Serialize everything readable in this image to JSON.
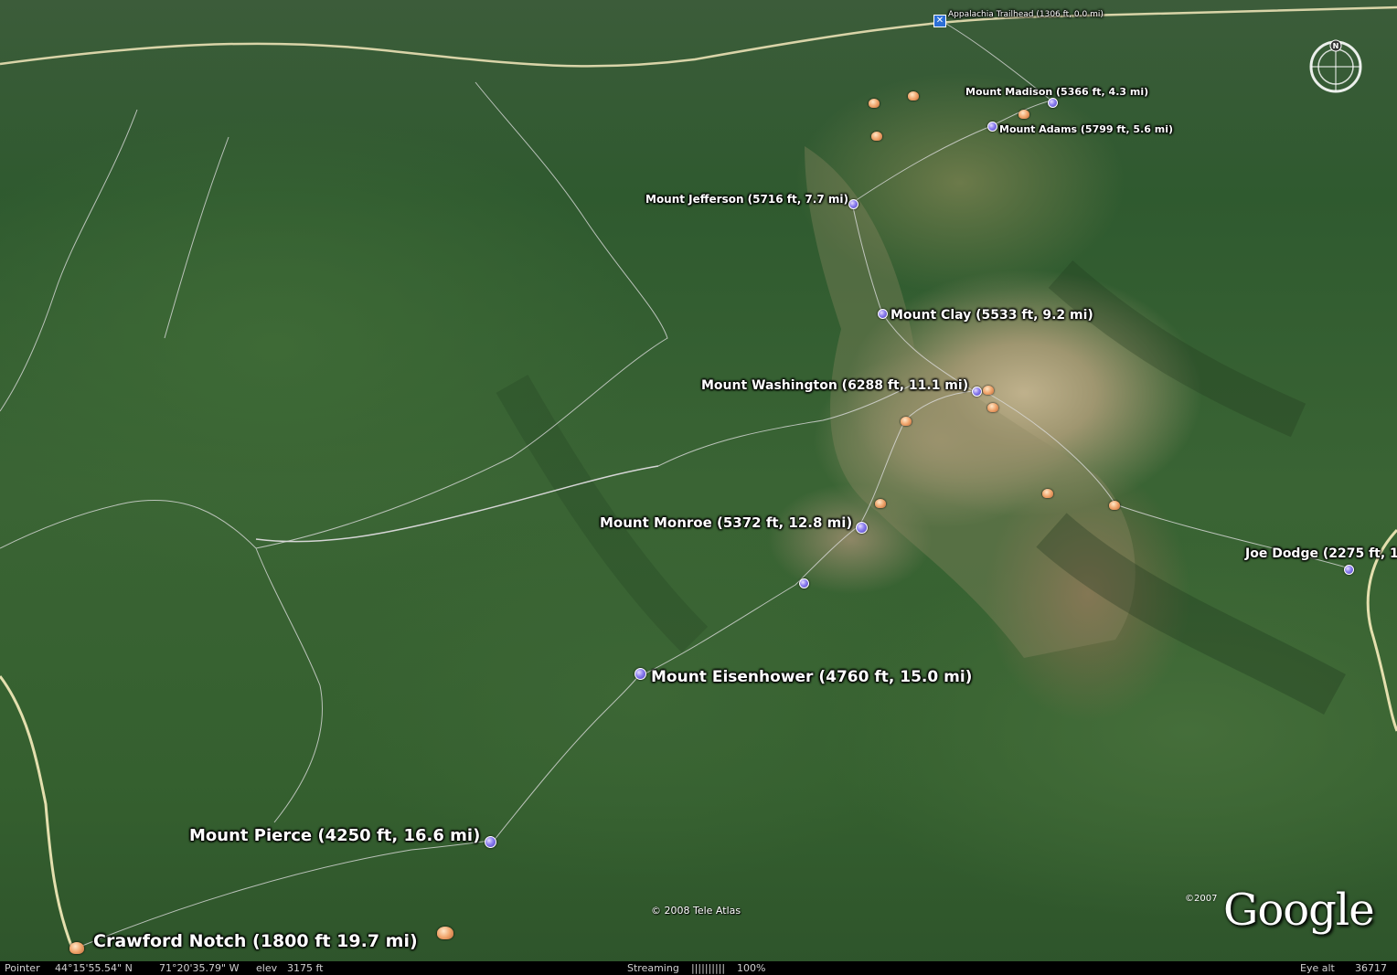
{
  "places": {
    "appalachia_trailhead": "Appalachia Trailhead (1306 ft, 0.0 mi)",
    "mount_madison": "Mount Madison (5366 ft, 4.3 mi)",
    "mount_adams": "Mount Adams (5799 ft, 5.6 mi)",
    "mount_jefferson": "Mount Jefferson (5716 ft, 7.7 mi)",
    "mount_clay": "Mount Clay (5533 ft, 9.2 mi)",
    "mount_washington": "Mount Washington (6288 ft, 11.1 mi)",
    "mount_monroe": "Mount Monroe (5372 ft, 12.8 mi)",
    "joe_dodge": "Joe Dodge (2275 ft, 1",
    "mount_eisenhower": "Mount Eisenhower (4760 ft, 15.0 mi)",
    "mount_pierce": "Mount Pierce (4250 ft, 16.6 mi)",
    "crawford_notch": "Crawford Notch (1800 ft 19.7 mi)"
  },
  "attribution": {
    "copyright": "© 2008 Tele Atlas",
    "logo_year": "©2007",
    "logo": "Google"
  },
  "compass": {
    "north_letter": "N"
  },
  "status_bar": {
    "pointer_label": "Pointer",
    "latitude": "44°15'55.54\" N",
    "longitude": "71°20'35.79\" W",
    "elev_label": "elev",
    "elev_value": "3175 ft",
    "streaming_label": "Streaming",
    "streaming_bar": "||||||||||",
    "streaming_pct": "100%",
    "eye_alt_label": "Eye alt",
    "eye_alt_value": "36717 ft"
  },
  "colors": {
    "waypoint_pin": "#8a7df0",
    "campsite_marker": "#f0a56c",
    "trailhead_marker": "#2d6fd6",
    "label_text": "#ffffff"
  }
}
